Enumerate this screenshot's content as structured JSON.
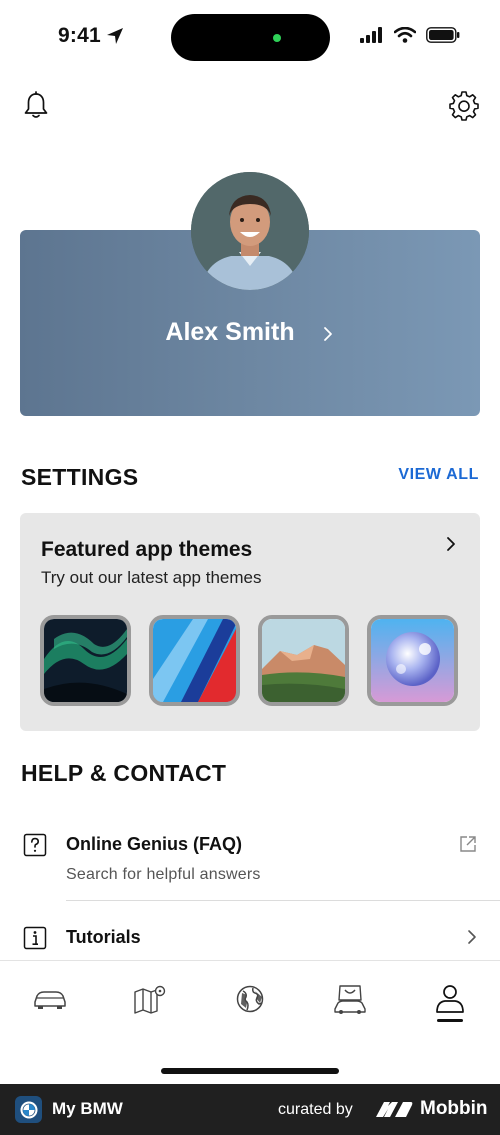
{
  "status_bar": {
    "time": "9:41"
  },
  "header": {
    "left_icon": "bell-icon",
    "right_icon": "gear-icon"
  },
  "profile": {
    "name": "Alex Smith"
  },
  "settings": {
    "title": "SETTINGS",
    "view_all_label": "VIEW ALL",
    "featured": {
      "title": "Featured app themes",
      "subtitle": "Try out our latest app themes",
      "themes": [
        "aurora",
        "motorsport-stripes",
        "mountain",
        "sphere"
      ]
    }
  },
  "help": {
    "title": "HELP & CONTACT",
    "items": [
      {
        "title": "Online Genius (FAQ)",
        "subtitle": "Search for helpful answers",
        "icon": "question-icon",
        "action_icon": "external-link-icon"
      },
      {
        "title": "Tutorials",
        "icon": "info-icon",
        "action_icon": "chevron-right-icon"
      }
    ]
  },
  "tab_bar": {
    "tabs": [
      "car-icon",
      "map-icon",
      "globe-icon",
      "shop-icon",
      "profile-icon"
    ],
    "active": "profile-icon"
  },
  "footer": {
    "app_name": "My BMW",
    "curated_by": "curated by",
    "brand": "Mobbin"
  },
  "colors": {
    "accent": "#1c69d4",
    "card_gradient_start": "#5d7590",
    "card_gradient_end": "#7b98b5",
    "themes_bg": "#e7e7e7"
  }
}
